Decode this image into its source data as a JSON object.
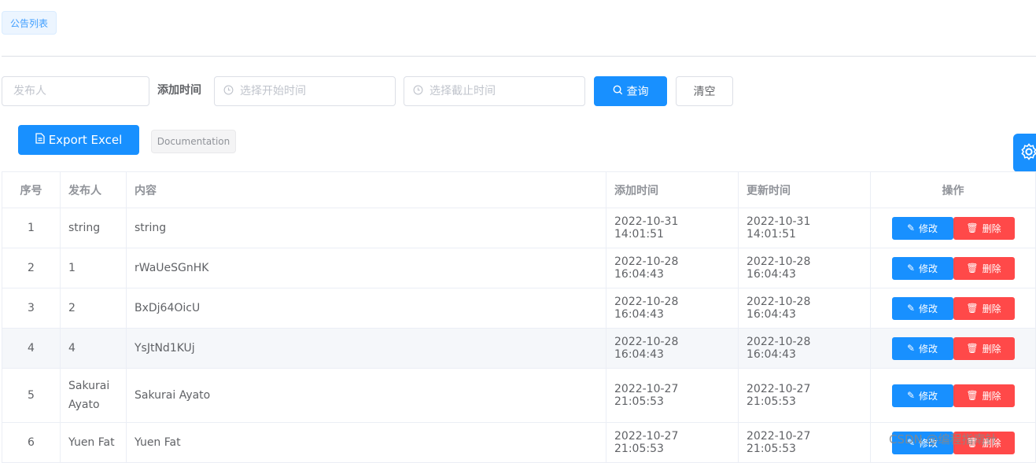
{
  "tag": "公告列表",
  "filters": {
    "publisher_placeholder": "发布人",
    "added_time_label": "添加时间",
    "start_placeholder": "选择开始时间",
    "end_placeholder": "选择截止时间",
    "query_label": "查询",
    "clear_label": "清空"
  },
  "toolbar": {
    "export_label": "Export Excel",
    "doc_label": "Documentation"
  },
  "table": {
    "columns": [
      "序号",
      "发布人",
      "内容",
      "添加时间",
      "更新时间",
      "操作"
    ],
    "edit_label": "修改",
    "delete_label": "删除",
    "rows": [
      {
        "no": "1",
        "publisher": "string",
        "content": "string",
        "added": "2022-10-31 14:01:51",
        "updated": "2022-10-31 14:01:51"
      },
      {
        "no": "2",
        "publisher": "1",
        "content": "rWaUeSGnHK",
        "added": "2022-10-28 16:04:43",
        "updated": "2022-10-28 16:04:43"
      },
      {
        "no": "3",
        "publisher": "2",
        "content": "BxDj64OicU",
        "added": "2022-10-28 16:04:43",
        "updated": "2022-10-28 16:04:43"
      },
      {
        "no": "4",
        "publisher": "4",
        "content": "YsJtNd1KUj",
        "added": "2022-10-28 16:04:43",
        "updated": "2022-10-28 16:04:43"
      },
      {
        "no": "5",
        "publisher": "Sakurai Ayato",
        "content": "Sakurai Ayato",
        "added": "2022-10-27 21:05:53",
        "updated": "2022-10-27 21:05:53"
      },
      {
        "no": "6",
        "publisher": "Yuen Fat",
        "content": "Yuen Fat",
        "added": "2022-10-27 21:05:53",
        "updated": "2022-10-27 21:05:53"
      }
    ]
  },
  "watermark": "CSDN @编程指南针",
  "colors": {
    "primary": "#1890ff",
    "danger": "#ff4949"
  }
}
